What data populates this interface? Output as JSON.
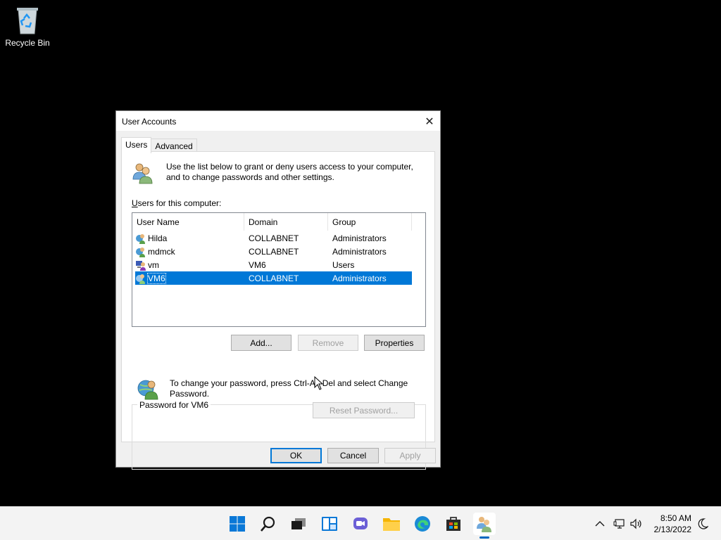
{
  "desktop": {
    "recycle_bin_label": "Recycle Bin"
  },
  "dialog": {
    "title": "User Accounts",
    "close_glyph": "✕",
    "tabs": [
      {
        "label": "Users",
        "active": true
      },
      {
        "label": "Advanced",
        "active": false
      }
    ],
    "intro_text_line1": "Use the list below to grant or deny users access to your computer,",
    "intro_text_line2": "and to change passwords and other settings.",
    "users_label_u": "U",
    "users_label_rest": "sers for this computer:",
    "list": {
      "columns": [
        "User Name",
        "Domain",
        "Group"
      ],
      "rows": [
        {
          "name": "Hilda",
          "domain": "COLLABNET",
          "group": "Administrators",
          "icon": "domain-user-icon"
        },
        {
          "name": "mdmck",
          "domain": "COLLABNET",
          "group": "Administrators",
          "icon": "domain-user-icon"
        },
        {
          "name": "vm",
          "domain": "VM6",
          "group": "Users",
          "icon": "local-user-icon"
        },
        {
          "name": "VM6",
          "domain": "COLLABNET",
          "group": "Administrators",
          "icon": "domain-user-icon",
          "selected": true
        }
      ]
    },
    "buttons": {
      "add": "Add...",
      "remove": "Remove",
      "properties": "Properties",
      "reset_password": "Reset Password...",
      "ok": "OK",
      "cancel": "Cancel",
      "apply": "Apply"
    },
    "password_group_label": "Password for VM6",
    "password_text_line1": "To change your password, press Ctrl-Alt-Del and select Change",
    "password_text_line2": "Password."
  },
  "taskbar": {
    "icons": [
      "start-icon",
      "search-icon",
      "task-view-icon",
      "widgets-icon",
      "chat-icon",
      "file-explorer-icon",
      "edge-icon",
      "store-icon",
      "user-accounts-icon"
    ],
    "active_icon": "user-accounts-icon",
    "time": "8:50 AM",
    "date": "2/13/2022"
  },
  "colors": {
    "accent": "#0078d7",
    "taskbar_bg": "#f3f3f3",
    "desktop_bg": "#000000"
  }
}
